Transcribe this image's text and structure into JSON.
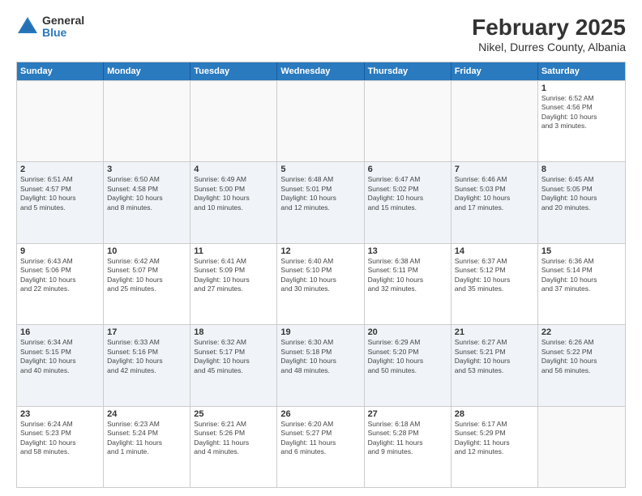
{
  "header": {
    "logo_general": "General",
    "logo_blue": "Blue",
    "title": "February 2025",
    "subtitle": "Nikel, Durres County, Albania"
  },
  "days_of_week": [
    "Sunday",
    "Monday",
    "Tuesday",
    "Wednesday",
    "Thursday",
    "Friday",
    "Saturday"
  ],
  "weeks": [
    {
      "alt": false,
      "cells": [
        {
          "day": "",
          "info": ""
        },
        {
          "day": "",
          "info": ""
        },
        {
          "day": "",
          "info": ""
        },
        {
          "day": "",
          "info": ""
        },
        {
          "day": "",
          "info": ""
        },
        {
          "day": "",
          "info": ""
        },
        {
          "day": "1",
          "info": "Sunrise: 6:52 AM\nSunset: 4:56 PM\nDaylight: 10 hours\nand 3 minutes."
        }
      ]
    },
    {
      "alt": true,
      "cells": [
        {
          "day": "2",
          "info": "Sunrise: 6:51 AM\nSunset: 4:57 PM\nDaylight: 10 hours\nand 5 minutes."
        },
        {
          "day": "3",
          "info": "Sunrise: 6:50 AM\nSunset: 4:58 PM\nDaylight: 10 hours\nand 8 minutes."
        },
        {
          "day": "4",
          "info": "Sunrise: 6:49 AM\nSunset: 5:00 PM\nDaylight: 10 hours\nand 10 minutes."
        },
        {
          "day": "5",
          "info": "Sunrise: 6:48 AM\nSunset: 5:01 PM\nDaylight: 10 hours\nand 12 minutes."
        },
        {
          "day": "6",
          "info": "Sunrise: 6:47 AM\nSunset: 5:02 PM\nDaylight: 10 hours\nand 15 minutes."
        },
        {
          "day": "7",
          "info": "Sunrise: 6:46 AM\nSunset: 5:03 PM\nDaylight: 10 hours\nand 17 minutes."
        },
        {
          "day": "8",
          "info": "Sunrise: 6:45 AM\nSunset: 5:05 PM\nDaylight: 10 hours\nand 20 minutes."
        }
      ]
    },
    {
      "alt": false,
      "cells": [
        {
          "day": "9",
          "info": "Sunrise: 6:43 AM\nSunset: 5:06 PM\nDaylight: 10 hours\nand 22 minutes."
        },
        {
          "day": "10",
          "info": "Sunrise: 6:42 AM\nSunset: 5:07 PM\nDaylight: 10 hours\nand 25 minutes."
        },
        {
          "day": "11",
          "info": "Sunrise: 6:41 AM\nSunset: 5:09 PM\nDaylight: 10 hours\nand 27 minutes."
        },
        {
          "day": "12",
          "info": "Sunrise: 6:40 AM\nSunset: 5:10 PM\nDaylight: 10 hours\nand 30 minutes."
        },
        {
          "day": "13",
          "info": "Sunrise: 6:38 AM\nSunset: 5:11 PM\nDaylight: 10 hours\nand 32 minutes."
        },
        {
          "day": "14",
          "info": "Sunrise: 6:37 AM\nSunset: 5:12 PM\nDaylight: 10 hours\nand 35 minutes."
        },
        {
          "day": "15",
          "info": "Sunrise: 6:36 AM\nSunset: 5:14 PM\nDaylight: 10 hours\nand 37 minutes."
        }
      ]
    },
    {
      "alt": true,
      "cells": [
        {
          "day": "16",
          "info": "Sunrise: 6:34 AM\nSunset: 5:15 PM\nDaylight: 10 hours\nand 40 minutes."
        },
        {
          "day": "17",
          "info": "Sunrise: 6:33 AM\nSunset: 5:16 PM\nDaylight: 10 hours\nand 42 minutes."
        },
        {
          "day": "18",
          "info": "Sunrise: 6:32 AM\nSunset: 5:17 PM\nDaylight: 10 hours\nand 45 minutes."
        },
        {
          "day": "19",
          "info": "Sunrise: 6:30 AM\nSunset: 5:18 PM\nDaylight: 10 hours\nand 48 minutes."
        },
        {
          "day": "20",
          "info": "Sunrise: 6:29 AM\nSunset: 5:20 PM\nDaylight: 10 hours\nand 50 minutes."
        },
        {
          "day": "21",
          "info": "Sunrise: 6:27 AM\nSunset: 5:21 PM\nDaylight: 10 hours\nand 53 minutes."
        },
        {
          "day": "22",
          "info": "Sunrise: 6:26 AM\nSunset: 5:22 PM\nDaylight: 10 hours\nand 56 minutes."
        }
      ]
    },
    {
      "alt": false,
      "cells": [
        {
          "day": "23",
          "info": "Sunrise: 6:24 AM\nSunset: 5:23 PM\nDaylight: 10 hours\nand 58 minutes."
        },
        {
          "day": "24",
          "info": "Sunrise: 6:23 AM\nSunset: 5:24 PM\nDaylight: 11 hours\nand 1 minute."
        },
        {
          "day": "25",
          "info": "Sunrise: 6:21 AM\nSunset: 5:26 PM\nDaylight: 11 hours\nand 4 minutes."
        },
        {
          "day": "26",
          "info": "Sunrise: 6:20 AM\nSunset: 5:27 PM\nDaylight: 11 hours\nand 6 minutes."
        },
        {
          "day": "27",
          "info": "Sunrise: 6:18 AM\nSunset: 5:28 PM\nDaylight: 11 hours\nand 9 minutes."
        },
        {
          "day": "28",
          "info": "Sunrise: 6:17 AM\nSunset: 5:29 PM\nDaylight: 11 hours\nand 12 minutes."
        },
        {
          "day": "",
          "info": ""
        }
      ]
    }
  ]
}
